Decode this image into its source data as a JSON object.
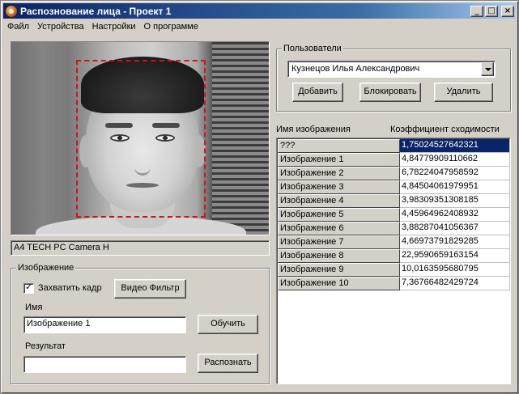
{
  "window": {
    "title": "Распознование лица - Проект 1",
    "buttons": [
      "_",
      "□",
      "×"
    ]
  },
  "menu": [
    "Файл",
    "Устройства",
    "Настройки",
    "О программе"
  ],
  "camera": {
    "device_name": "A4 TECH PC Camera H",
    "face_box_color": "#d11515"
  },
  "image_group": {
    "legend": "Изображение",
    "capture_label": "Захватить кадр",
    "capture_checked": true,
    "video_filter_button": "Видео Фильтр",
    "name_label": "Имя",
    "name_value": "Изображение 1",
    "train_button": "Обучить",
    "result_label": "Результат",
    "result_value": "",
    "recognize_button": "Распознать"
  },
  "users_group": {
    "legend": "Пользователи",
    "selected_user": "Кузнецов Илья Александрович",
    "add_button": "Добавить",
    "block_button": "Блокировать",
    "delete_button": "Удалить"
  },
  "table": {
    "col_name": "Имя изображения",
    "col_score": "Коэффициент сходимости",
    "rows": [
      {
        "name": "???",
        "score": "1,75024527642321"
      },
      {
        "name": "Изображение 1",
        "score": "4,84779909110662"
      },
      {
        "name": "Изображение 2",
        "score": "6,78224047958592"
      },
      {
        "name": "Изображение 3",
        "score": "4,84504061979951"
      },
      {
        "name": "Изображение 4",
        "score": "3,98309351308185"
      },
      {
        "name": "Изображение 5",
        "score": "4,45964962408932"
      },
      {
        "name": "Изображение 6",
        "score": "3,88287041056367"
      },
      {
        "name": "Изображение 7",
        "score": "4,66973791829285"
      },
      {
        "name": "Изображение 8",
        "score": "22,9590659163154"
      },
      {
        "name": "Изображение 9",
        "score": "10,0163595680795"
      },
      {
        "name": "Изображение 10",
        "score": "7,36766482429724"
      }
    ],
    "selected_accent": "#0a246a"
  }
}
